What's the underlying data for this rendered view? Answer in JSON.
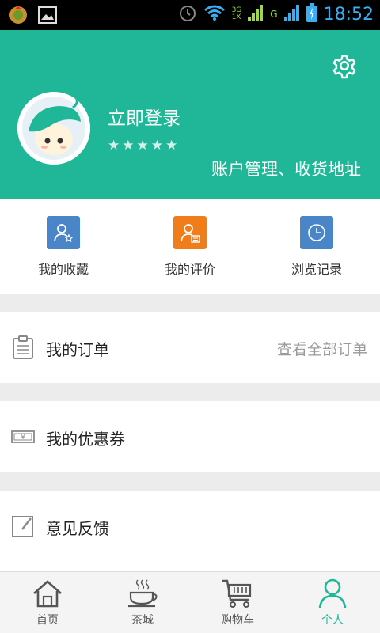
{
  "status_bar": {
    "time": "18:52",
    "network_3g": "3G",
    "network_1x": "1X",
    "network_g": "G"
  },
  "profile": {
    "login_label": "立即登录",
    "rating_stars": 5,
    "account_link": "账户管理、收货地址"
  },
  "shortcuts": [
    {
      "label": "我的收藏",
      "icon": "user-star-icon",
      "color": "#4a86c7"
    },
    {
      "label": "我的评价",
      "icon": "user-comment-icon",
      "color": "#f07d1a"
    },
    {
      "label": "浏览记录",
      "icon": "clock-icon",
      "color": "#4a86c7"
    }
  ],
  "menu": {
    "orders": {
      "label": "我的订单",
      "link": "查看全部订单"
    },
    "coupons": {
      "label": "我的优惠券"
    },
    "feedback": {
      "label": "意见反馈"
    }
  },
  "bottom_nav": [
    {
      "label": "首页",
      "icon": "home-icon",
      "active": false
    },
    {
      "label": "茶城",
      "icon": "tea-cup-icon",
      "active": false
    },
    {
      "label": "购物车",
      "icon": "cart-icon",
      "active": false
    },
    {
      "label": "个人",
      "icon": "person-icon",
      "active": true
    }
  ],
  "colors": {
    "accent": "#1fb797",
    "orange": "#f07d1a",
    "blue": "#4a86c7"
  }
}
